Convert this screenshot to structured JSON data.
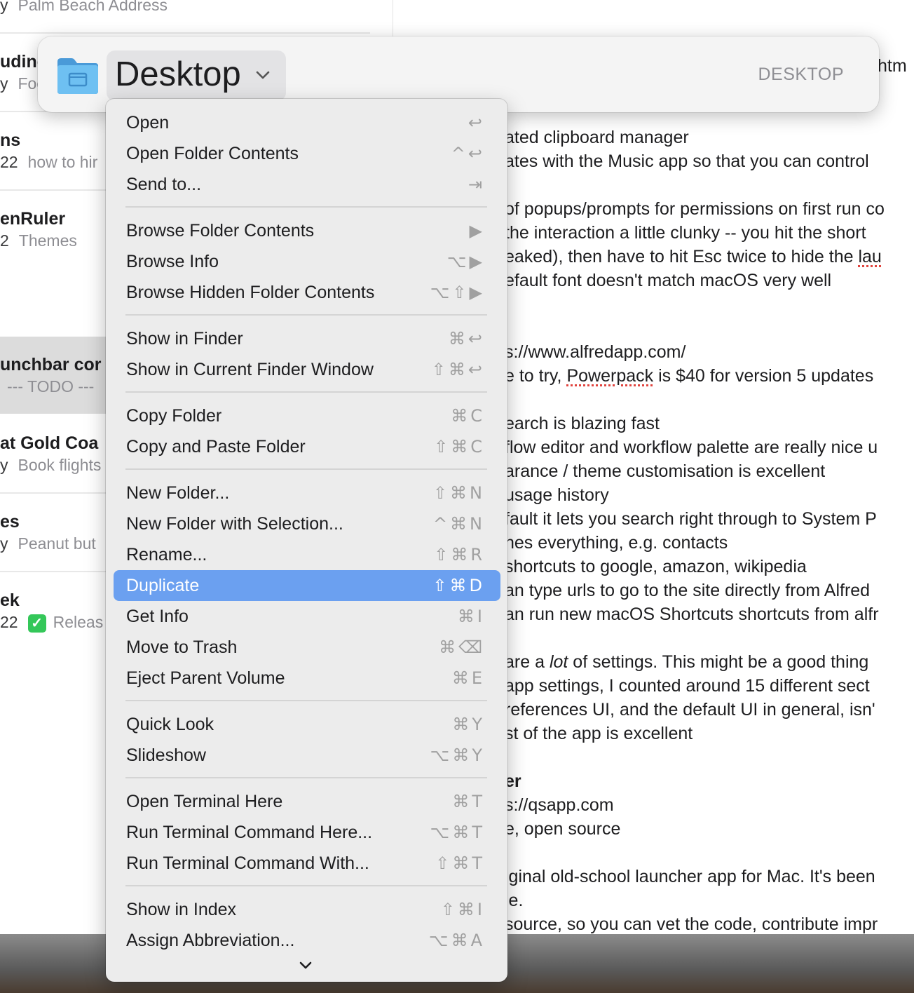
{
  "notes_list": {
    "items": [
      {
        "title": "",
        "date": "y",
        "snippet": "Palm Beach Address"
      },
      {
        "title": "uding",
        "date": "y",
        "snippet": "Foo"
      },
      {
        "title": "ns",
        "date": "22",
        "snippet": "how to hir"
      },
      {
        "title": "enRuler",
        "date": "2",
        "snippet": "Themes"
      },
      {
        "title": "unchbar cor",
        "date": "",
        "snippet": "--- TODO ---"
      },
      {
        "title": "at Gold Coa",
        "date": "y",
        "snippet": "Book flights"
      },
      {
        "title": "es",
        "date": "y",
        "snippet": "Peanut but"
      },
      {
        "title": "ek",
        "date": "22",
        "snippet": "Releas"
      }
    ]
  },
  "note_body": {
    "header_fragment": "htm",
    "lines": [
      "ated clipboard manager",
      "ates with the Music app so that you can control",
      "",
      "of popups/prompts for permissions on first run co",
      "the interaction a little clunky -- you hit the short",
      "eaked), then have to hit Esc twice to hide the lau",
      "efault font doesn't match macOS very well",
      "",
      "",
      "s://www.alfredapp.com/",
      "e to try, Powerpack is $40 for version 5 updates",
      "",
      "earch is blazing fast",
      "flow editor and workflow palette are really nice u",
      "arance / theme customisation is excellent",
      "usage history",
      "fault it lets you search right through to System P",
      "hes everything, e.g. contacts",
      " shortcuts to google, amazon, wikipedia",
      "an type urls to go to the site directly from Alfred",
      "an run new macOS Shortcuts shortcuts from alfr",
      "",
      " are a lot of settings. This might be a good thing",
      " app settings, I counted around 15 different sect",
      "references UI, and the default UI in general, isn'",
      "st of the app is excellent",
      "",
      "er",
      "s://qsapp.com",
      "e, open source",
      "",
      "iginal old-school launcher app for Mac. It's been",
      "le.",
      "source, so you can vet the code, contribute impr"
    ]
  },
  "launcher": {
    "folder_name": "Desktop",
    "right_label": "DESKTOP"
  },
  "action_menu": {
    "groups": [
      [
        {
          "label": "Open",
          "shortcut": "↩"
        },
        {
          "label": "Open Folder Contents",
          "shortcut": "^↩"
        },
        {
          "label": "Send to...",
          "shortcut": "⇥"
        }
      ],
      [
        {
          "label": "Browse Folder Contents",
          "shortcut": "▶"
        },
        {
          "label": "Browse Info",
          "shortcut": "⌥▶"
        },
        {
          "label": "Browse Hidden Folder Contents",
          "shortcut": "⌥⇧▶"
        }
      ],
      [
        {
          "label": "Show in Finder",
          "shortcut": "⌘↩"
        },
        {
          "label": "Show in Current Finder Window",
          "shortcut": "⇧⌘↩"
        }
      ],
      [
        {
          "label": "Copy Folder",
          "shortcut": "⌘C"
        },
        {
          "label": "Copy and Paste Folder",
          "shortcut": "⇧⌘C"
        }
      ],
      [
        {
          "label": "New Folder...",
          "shortcut": "⇧⌘N"
        },
        {
          "label": "New Folder with Selection...",
          "shortcut": "^⌘N"
        },
        {
          "label": "Rename...",
          "shortcut": "⇧⌘R"
        },
        {
          "label": "Duplicate",
          "shortcut": "⇧⌘D",
          "active": true
        },
        {
          "label": "Get Info",
          "shortcut": "⌘I"
        },
        {
          "label": "Move to Trash",
          "shortcut": "⌘⌫"
        },
        {
          "label": "Eject Parent Volume",
          "shortcut": "⌘E"
        }
      ],
      [
        {
          "label": "Quick Look",
          "shortcut": "⌘Y"
        },
        {
          "label": "Slideshow",
          "shortcut": "⌥⌘Y"
        }
      ],
      [
        {
          "label": "Open Terminal Here",
          "shortcut": "⌘T"
        },
        {
          "label": "Run Terminal Command Here...",
          "shortcut": "⌥⌘T"
        },
        {
          "label": "Run Terminal Command With...",
          "shortcut": "⇧⌘T"
        }
      ],
      [
        {
          "label": "Show in Index",
          "shortcut": "⇧⌘I"
        },
        {
          "label": "Assign Abbreviation...",
          "shortcut": "⌥⌘A"
        }
      ]
    ]
  },
  "colors": {
    "menu_highlight": "#6ba0f0",
    "folder_blue": "#5ab0ea",
    "menu_background": "#ececec"
  }
}
